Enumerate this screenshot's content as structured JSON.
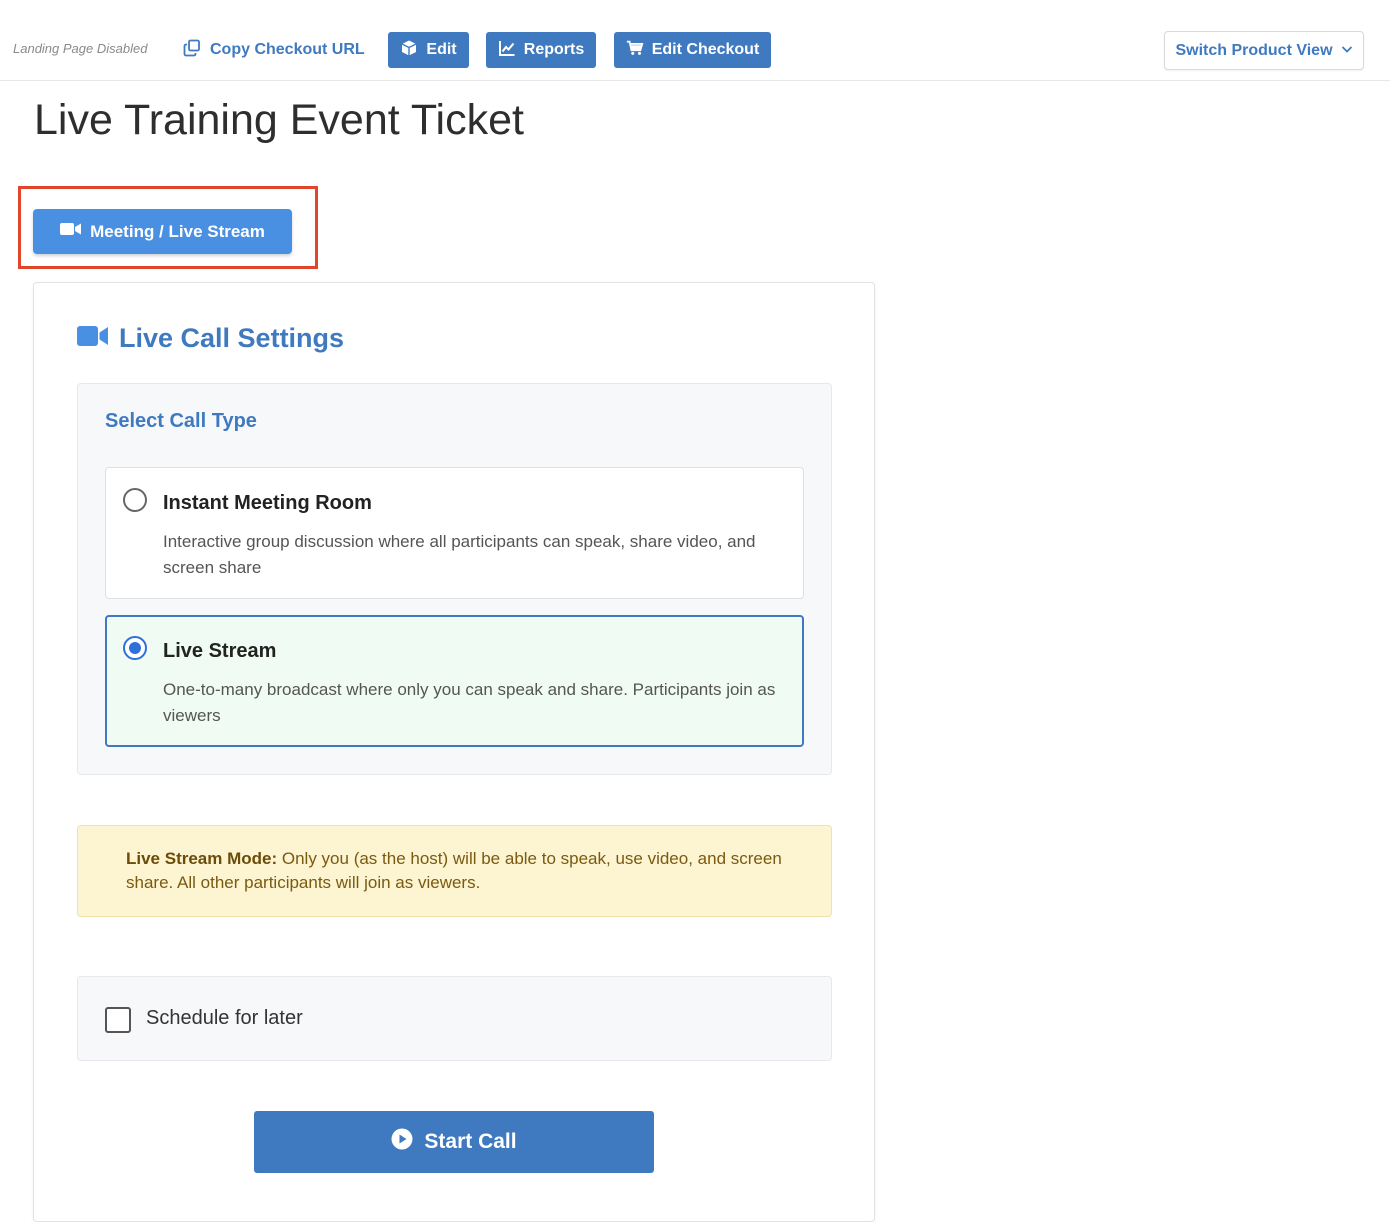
{
  "topbar": {
    "landing_status": "Landing Page Disabled",
    "copy_checkout_url": "Copy Checkout URL",
    "edit": "Edit",
    "reports": "Reports",
    "edit_checkout": "Edit Checkout",
    "switch_product_view": "Switch Product View",
    "icons": [
      "copy-icon",
      "cube-icon",
      "chart-line-icon",
      "cart-icon",
      "chevron-down-icon"
    ]
  },
  "page": {
    "title": "Live Training Event Ticket"
  },
  "meeting_button": {
    "label": "Meeting / Live Stream",
    "icon": "video-camera-icon",
    "highlight_color": "#e0462c"
  },
  "live_call": {
    "title": "Live Call Settings",
    "icon": "video-camera-icon",
    "call_type_heading": "Select Call Type",
    "options": [
      {
        "title": "Instant Meeting Room",
        "description": "Interactive group discussion where all participants can speak, share video, and screen share",
        "selected": false
      },
      {
        "title": "Live Stream",
        "description": "One-to-many broadcast where only you can speak and share. Participants join as viewers",
        "selected": true
      }
    ],
    "notice": {
      "label": "Live Stream Mode:",
      "text": " Only you (as the host) will be able to speak, use video, and screen share. All other participants will join as viewers."
    },
    "schedule": {
      "label": "Schedule for later",
      "checked": false
    },
    "start_call": {
      "label": "Start Call",
      "icon": "play-circle-icon"
    }
  },
  "colors": {
    "primary": "#3f7ac0",
    "meeting_button": "#4a90e2",
    "selected_option_bg": "#f0fbf3",
    "notice_bg": "#fdf4d2"
  }
}
